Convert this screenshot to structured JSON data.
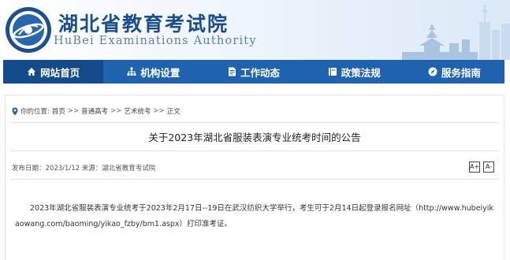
{
  "header": {
    "title": "湖北省教育考试院",
    "subtitle": "HuBei Examinations Authority",
    "logo_ring_text": "湖北省教育考试院"
  },
  "nav": {
    "items": [
      {
        "label": "网站首页",
        "icon": "home-icon"
      },
      {
        "label": "机构设置",
        "icon": "org-chart-icon"
      },
      {
        "label": "工作动态",
        "icon": "document-icon"
      },
      {
        "label": "政策法规",
        "icon": "book-icon"
      },
      {
        "label": "服务指南",
        "icon": "compass-icon"
      }
    ]
  },
  "breadcrumb": {
    "prefix": "你的位置:",
    "items": [
      "首页",
      "普通高考",
      "艺术统考",
      "正文"
    ],
    "separator": ">>"
  },
  "article": {
    "title": "关于2023年湖北省服装表演专业统考时间的公告",
    "meta": "发布日期：2023/1/12 来源：湖北省教育考试院",
    "font_increase": "A+",
    "font_decrease": "A-",
    "body": "2023年湖北省服装表演专业统考于2023年2月17日--19日在武汉纺织大学举行，考生可于2月14日起登录报名网址（http://www.hubeiyikaowang.com/baoming/yikao_fzby/bm1.aspx）打印准考证。"
  },
  "colors": {
    "nav_bg": "#1f62ad",
    "nav_active": "#124a8a",
    "title_blue": "#1a4d8c"
  }
}
